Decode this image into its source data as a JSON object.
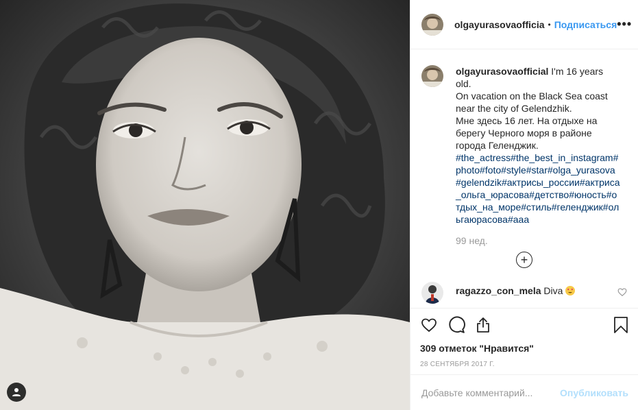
{
  "header": {
    "username": "olgayurasovaofficia",
    "dot": "•",
    "follow_label": "Подписаться",
    "more_label": "•••"
  },
  "caption": {
    "username": "olgayurasovaofficial",
    "text_lines": [
      "I'm 16 years old.",
      "On vacation on the Black Sea coast",
      "near the city of Gelendzhik.",
      "Мне здесь 16 лет. На отдыхе на",
      "берегу Черного моря в районе",
      "города Геленджик."
    ],
    "tags": "#the_actress#the_best_in_instagram#photo#foto#style#star#olga_yurasova#gelendzik#актрисы_россии#актриса_ольга_юрасова#детство#юность#отдых_на_море#стиль#геленджик#ольгаюрасова#ааа",
    "age": "99 нед."
  },
  "load_more": {
    "label": "+"
  },
  "comments": [
    {
      "username": "ragazzo_con_mela",
      "text": "Diva",
      "emoji": "heart-eyes"
    }
  ],
  "actions": {
    "likes": "309 отметок \"Нравится\"",
    "date": "28 СЕНТЯБРЯ 2017 Г."
  },
  "add_comment": {
    "placeholder": "Добавьте комментарий...",
    "publish_label": "Опубликовать"
  },
  "colors": {
    "link_blue": "#3897f0",
    "hashtag": "#003569",
    "publish_disabled": "#b2dffc",
    "muted": "#999999"
  }
}
